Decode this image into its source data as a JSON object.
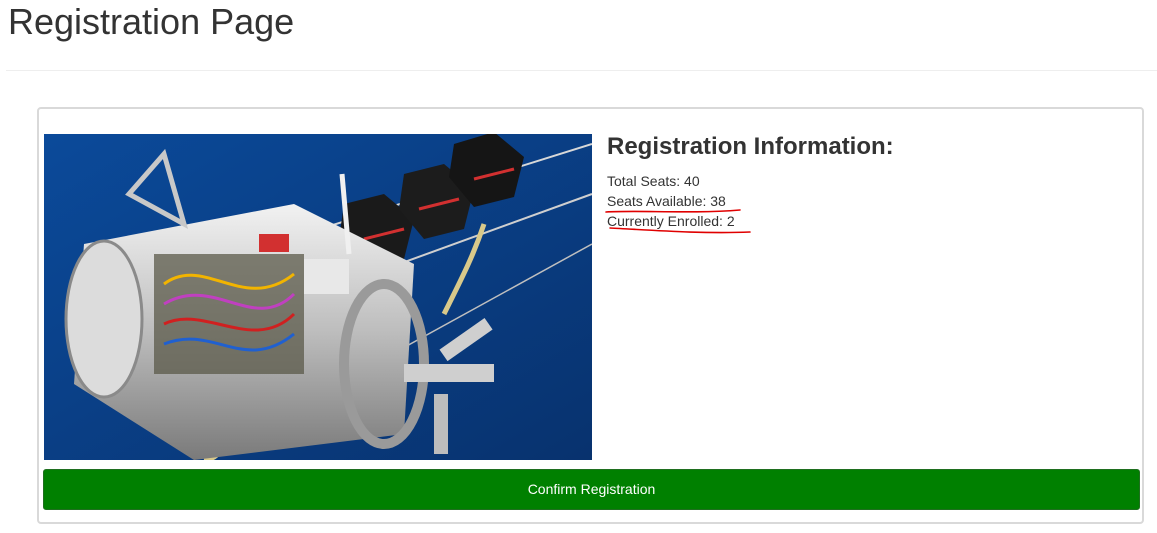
{
  "page": {
    "title": "Registration Page"
  },
  "registration": {
    "heading": "Registration Information:",
    "total_seats": "Total Seats: 40",
    "seats_available": "Seats Available: 38",
    "currently_enrolled": "Currently Enrolled: 2"
  },
  "actions": {
    "confirm_label": "Confirm Registration"
  },
  "image": {
    "subject": "snake-like robot with exposed electronics on blue background"
  },
  "colors": {
    "button": "#008000",
    "annotation_underline": "#e00000",
    "image_background": "#0a3f86"
  }
}
